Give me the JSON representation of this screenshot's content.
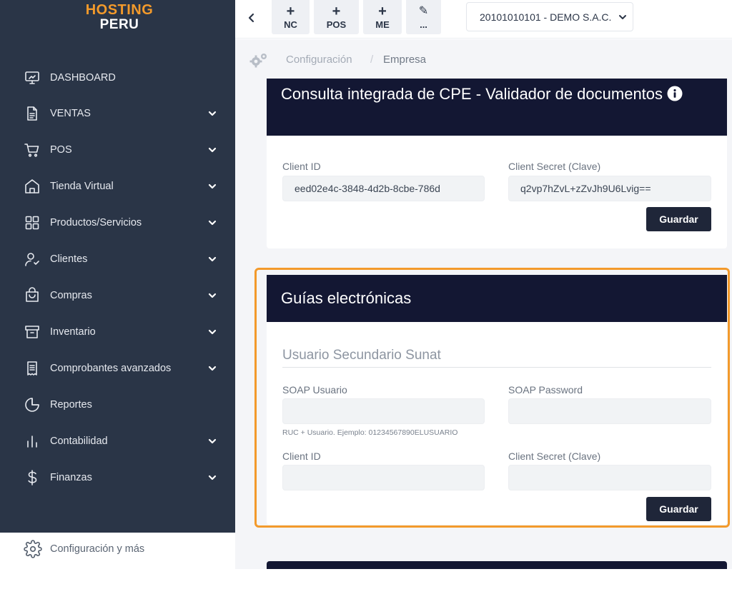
{
  "brand": {
    "line1": "HOSTING",
    "line2": "PERU"
  },
  "sidebar": {
    "items": [
      {
        "label": "DASHBOARD",
        "icon": "monitor-icon",
        "has_submenu": false
      },
      {
        "label": "VENTAS",
        "icon": "document-icon",
        "has_submenu": true
      },
      {
        "label": "POS",
        "icon": "cart-icon",
        "has_submenu": true
      },
      {
        "label": "Tienda Virtual",
        "icon": "store-icon",
        "has_submenu": true
      },
      {
        "label": "Productos/Servicios",
        "icon": "grid-icon",
        "has_submenu": true
      },
      {
        "label": "Clientes",
        "icon": "user-check-icon",
        "has_submenu": true
      },
      {
        "label": "Compras",
        "icon": "shopping-bag-icon",
        "has_submenu": true
      },
      {
        "label": "Inventario",
        "icon": "archive-icon",
        "has_submenu": true
      },
      {
        "label": "Comprobantes avanzados",
        "icon": "receipt-icon",
        "has_submenu": true
      },
      {
        "label": "Reportes",
        "icon": "pie-chart-icon",
        "has_submenu": false
      },
      {
        "label": "Contabilidad",
        "icon": "bar-chart-icon",
        "has_submenu": true
      },
      {
        "label": "Finanzas",
        "icon": "dollar-icon",
        "has_submenu": true
      }
    ],
    "config_label": "Configuración y más"
  },
  "topbar": {
    "quick_actions": [
      {
        "symbol": "+",
        "label": "NC"
      },
      {
        "symbol": "+",
        "label": "POS"
      },
      {
        "symbol": "+",
        "label": "ME"
      },
      {
        "symbol": "✎",
        "label": "..."
      }
    ],
    "company": "20101010101 - DEMO S.A.C."
  },
  "breadcrumb": {
    "parent": "Configuración",
    "separator": "/",
    "current": "Empresa"
  },
  "cpe_card": {
    "title": "Consulta integrada de CPE - Validador de documentos",
    "client_id_label": "Client ID",
    "client_id_value": "eed02e4c-3848-4d2b-8cbe-786d",
    "client_secret_label": "Client Secret (Clave)",
    "client_secret_value": "q2vp7hZvL+zZvJh9U6Lvig==",
    "save_label": "Guardar"
  },
  "guias_card": {
    "title": "Guías electrónicas",
    "subtitle": "Usuario Secundario Sunat",
    "soap_user_label": "SOAP Usuario",
    "soap_user_value": "",
    "soap_user_hint": "RUC + Usuario. Ejemplo: 01234567890ELUSUARIO",
    "soap_password_label": "SOAP Password",
    "soap_password_value": "",
    "client_id_label": "Client ID",
    "client_id_value": "",
    "client_secret_label": "Client Secret (Clave)",
    "client_secret_value": "",
    "save_label": "Guardar"
  },
  "colors": {
    "sidebar_bg": "#2a3547",
    "card_header_bg": "#131733",
    "accent_orange": "#f39a2b",
    "button_bg": "#1f2639"
  }
}
